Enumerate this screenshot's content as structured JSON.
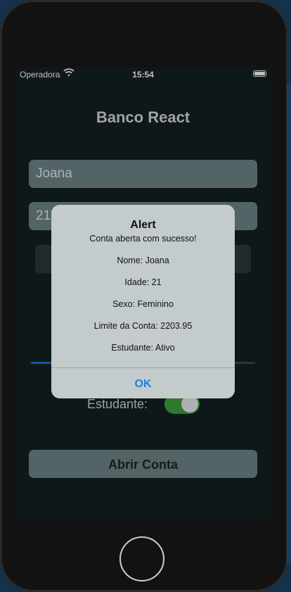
{
  "status_bar": {
    "carrier": "Operadora",
    "time": "15:54"
  },
  "app": {
    "title": "Banco React",
    "submit_label": "Abrir Conta"
  },
  "form": {
    "name_value": "Joana",
    "age_value": "21",
    "student_label": "Estudante:",
    "student_on": true,
    "limit_slider_fraction": 0.12
  },
  "alert": {
    "title": "Alert",
    "message_lines": [
      "Conta aberta com sucesso!",
      "Nome: Joana",
      "Idade: 21",
      "Sexo: Feminino",
      "Limite da Conta: 2203.95",
      "Estudante: Ativo"
    ],
    "ok_label": "OK"
  },
  "colors": {
    "background": "#142122",
    "field": "#6f8688",
    "accent_blue": "#1a7fe0",
    "switch_green": "#3fa13d"
  }
}
